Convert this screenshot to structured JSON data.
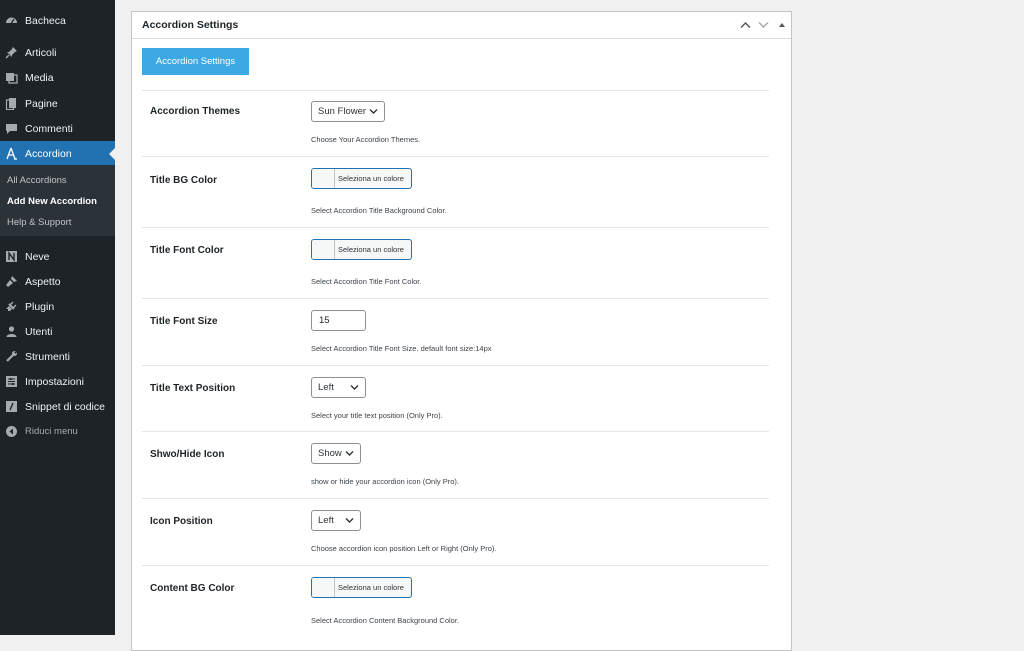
{
  "sidebar": {
    "items": [
      {
        "label": "Bacheca",
        "icon": "dashboard-icon"
      },
      {
        "label": "Articoli",
        "icon": "pin-icon"
      },
      {
        "label": "Media",
        "icon": "media-icon"
      },
      {
        "label": "Pagine",
        "icon": "pages-icon"
      },
      {
        "label": "Commenti",
        "icon": "comments-icon"
      },
      {
        "label": "Accordion",
        "icon": "accordion-icon"
      }
    ],
    "submenu": [
      "All Accordions",
      "Add New Accordion",
      "Help & Support"
    ],
    "items2": [
      {
        "label": "Neve",
        "icon": "neve-icon"
      },
      {
        "label": "Aspetto",
        "icon": "appearance-icon"
      },
      {
        "label": "Plugin",
        "icon": "plugin-icon"
      },
      {
        "label": "Utenti",
        "icon": "users-icon"
      },
      {
        "label": "Strumenti",
        "icon": "tools-icon"
      },
      {
        "label": "Impostazioni",
        "icon": "settings-icon"
      },
      {
        "label": "Snippet di codice",
        "icon": "code-icon"
      }
    ],
    "collapse": "Riduci menu",
    "accent": "#2271b1"
  },
  "panel": {
    "title": "Accordion Settings",
    "button": "Accordion Settings",
    "rows": [
      {
        "label": "Accordion Themes",
        "value": "Sun Flower",
        "desc": "Choose Your Accordion Themes."
      },
      {
        "label": "Title BG Color",
        "value": "Seleziona un colore",
        "desc": "Select Accordion Title Background Color."
      },
      {
        "label": "Title Font Color",
        "value": "Seleziona un colore",
        "desc": "Select Accordion Title Font Color."
      },
      {
        "label": "Title Font Size",
        "value": "15",
        "desc": "Select Accordion Title Font Size. default font size:14px"
      },
      {
        "label": "Title Text Position",
        "value": "Left",
        "desc": "Select your title text position (Only Pro)."
      },
      {
        "label": "Shwo/Hide Icon",
        "value": "Show",
        "desc": "show or hide your accordion icon (Only Pro)."
      },
      {
        "label": "Icon Position",
        "value": "Left",
        "desc": "Choose accordion icon position Left or Right (Only Pro)."
      },
      {
        "label": "Content BG Color",
        "value": "Seleziona un colore",
        "desc": "Select Accordion Content Background Color."
      }
    ]
  }
}
